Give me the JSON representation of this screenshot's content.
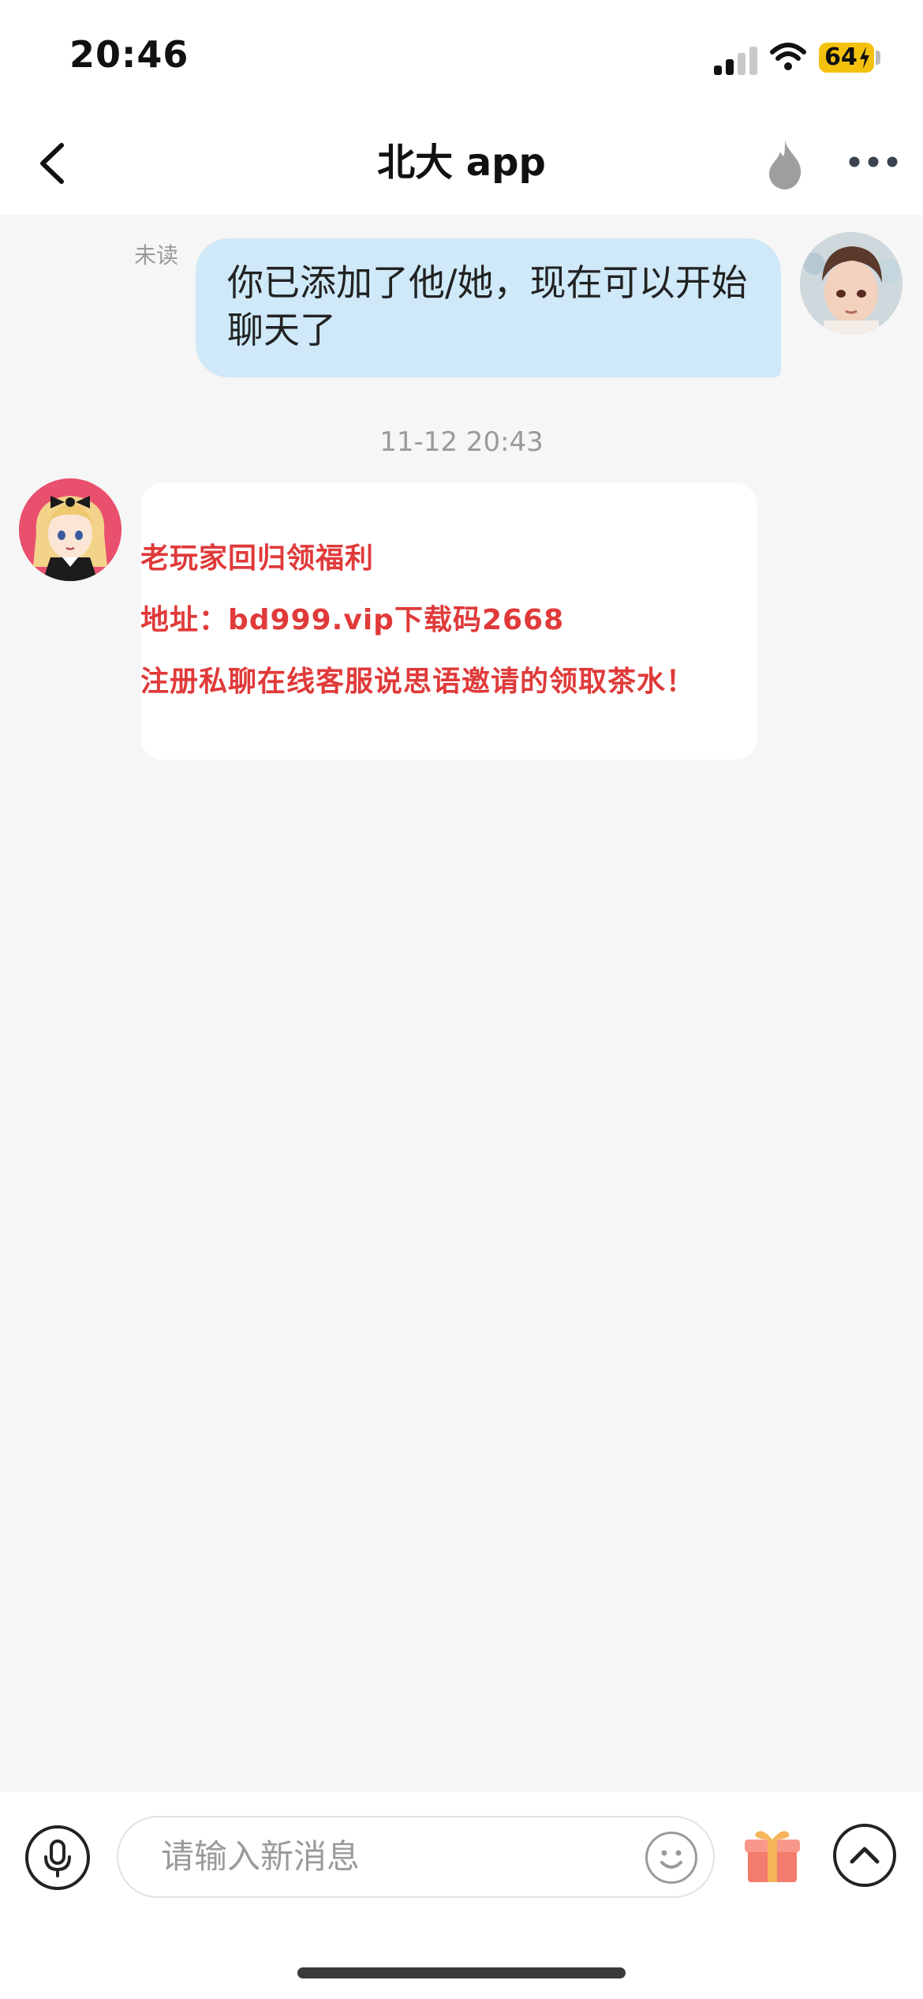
{
  "status_bar": {
    "time": "20:46",
    "battery_level": "64",
    "signal_bars_active": 2,
    "signal_bars_total": 4
  },
  "header": {
    "title": "北大 app",
    "back_icon": "chevron-left-icon",
    "flame_icon": "flame-icon",
    "more_icon": "more-dots-icon"
  },
  "chat": {
    "messages": [
      {
        "sender": "me",
        "status": "未读",
        "text": "你已添加了他/她，现在可以开始聊天了"
      },
      {
        "timestamp": "11-12 20:43"
      },
      {
        "sender": "other",
        "image_lines": [
          "老玩家回归领福利",
          "地址：bd999.vip下载码2668",
          "注册私聊在线客服说思语邀请的领取茶水！"
        ]
      }
    ]
  },
  "composer": {
    "placeholder": "请输入新消息",
    "mic_icon": "microphone-icon",
    "emoji_icon": "emoji-icon",
    "gift_icon": "gift-icon",
    "expand_icon": "chevron-up-circle-icon"
  },
  "colors": {
    "my_bubble": "#cfe9f8",
    "image_text": "#e03a3a",
    "battery": "#f4c20d"
  }
}
